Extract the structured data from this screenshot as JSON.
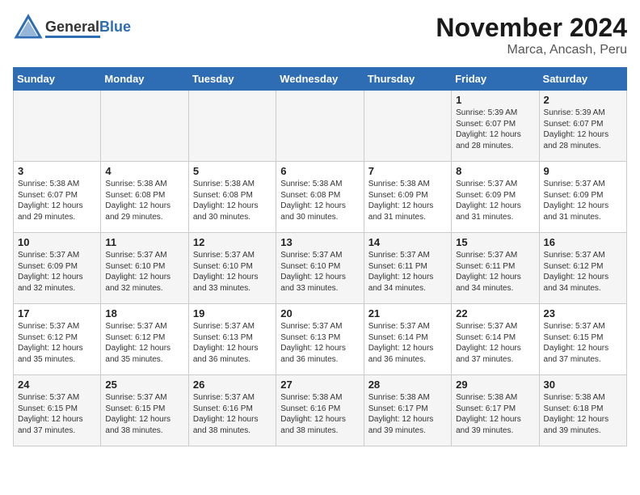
{
  "header": {
    "logo_general": "General",
    "logo_blue": "Blue",
    "title": "November 2024",
    "subtitle": "Marca, Ancash, Peru"
  },
  "calendar": {
    "days_of_week": [
      "Sunday",
      "Monday",
      "Tuesday",
      "Wednesday",
      "Thursday",
      "Friday",
      "Saturday"
    ],
    "weeks": [
      [
        {
          "day": "",
          "content": ""
        },
        {
          "day": "",
          "content": ""
        },
        {
          "day": "",
          "content": ""
        },
        {
          "day": "",
          "content": ""
        },
        {
          "day": "",
          "content": ""
        },
        {
          "day": "1",
          "content": "Sunrise: 5:39 AM\nSunset: 6:07 PM\nDaylight: 12 hours and 28 minutes."
        },
        {
          "day": "2",
          "content": "Sunrise: 5:39 AM\nSunset: 6:07 PM\nDaylight: 12 hours and 28 minutes."
        }
      ],
      [
        {
          "day": "3",
          "content": "Sunrise: 5:38 AM\nSunset: 6:07 PM\nDaylight: 12 hours and 29 minutes."
        },
        {
          "day": "4",
          "content": "Sunrise: 5:38 AM\nSunset: 6:08 PM\nDaylight: 12 hours and 29 minutes."
        },
        {
          "day": "5",
          "content": "Sunrise: 5:38 AM\nSunset: 6:08 PM\nDaylight: 12 hours and 30 minutes."
        },
        {
          "day": "6",
          "content": "Sunrise: 5:38 AM\nSunset: 6:08 PM\nDaylight: 12 hours and 30 minutes."
        },
        {
          "day": "7",
          "content": "Sunrise: 5:38 AM\nSunset: 6:09 PM\nDaylight: 12 hours and 31 minutes."
        },
        {
          "day": "8",
          "content": "Sunrise: 5:37 AM\nSunset: 6:09 PM\nDaylight: 12 hours and 31 minutes."
        },
        {
          "day": "9",
          "content": "Sunrise: 5:37 AM\nSunset: 6:09 PM\nDaylight: 12 hours and 31 minutes."
        }
      ],
      [
        {
          "day": "10",
          "content": "Sunrise: 5:37 AM\nSunset: 6:09 PM\nDaylight: 12 hours and 32 minutes."
        },
        {
          "day": "11",
          "content": "Sunrise: 5:37 AM\nSunset: 6:10 PM\nDaylight: 12 hours and 32 minutes."
        },
        {
          "day": "12",
          "content": "Sunrise: 5:37 AM\nSunset: 6:10 PM\nDaylight: 12 hours and 33 minutes."
        },
        {
          "day": "13",
          "content": "Sunrise: 5:37 AM\nSunset: 6:10 PM\nDaylight: 12 hours and 33 minutes."
        },
        {
          "day": "14",
          "content": "Sunrise: 5:37 AM\nSunset: 6:11 PM\nDaylight: 12 hours and 34 minutes."
        },
        {
          "day": "15",
          "content": "Sunrise: 5:37 AM\nSunset: 6:11 PM\nDaylight: 12 hours and 34 minutes."
        },
        {
          "day": "16",
          "content": "Sunrise: 5:37 AM\nSunset: 6:12 PM\nDaylight: 12 hours and 34 minutes."
        }
      ],
      [
        {
          "day": "17",
          "content": "Sunrise: 5:37 AM\nSunset: 6:12 PM\nDaylight: 12 hours and 35 minutes."
        },
        {
          "day": "18",
          "content": "Sunrise: 5:37 AM\nSunset: 6:12 PM\nDaylight: 12 hours and 35 minutes."
        },
        {
          "day": "19",
          "content": "Sunrise: 5:37 AM\nSunset: 6:13 PM\nDaylight: 12 hours and 36 minutes."
        },
        {
          "day": "20",
          "content": "Sunrise: 5:37 AM\nSunset: 6:13 PM\nDaylight: 12 hours and 36 minutes."
        },
        {
          "day": "21",
          "content": "Sunrise: 5:37 AM\nSunset: 6:14 PM\nDaylight: 12 hours and 36 minutes."
        },
        {
          "day": "22",
          "content": "Sunrise: 5:37 AM\nSunset: 6:14 PM\nDaylight: 12 hours and 37 minutes."
        },
        {
          "day": "23",
          "content": "Sunrise: 5:37 AM\nSunset: 6:15 PM\nDaylight: 12 hours and 37 minutes."
        }
      ],
      [
        {
          "day": "24",
          "content": "Sunrise: 5:37 AM\nSunset: 6:15 PM\nDaylight: 12 hours and 37 minutes."
        },
        {
          "day": "25",
          "content": "Sunrise: 5:37 AM\nSunset: 6:15 PM\nDaylight: 12 hours and 38 minutes."
        },
        {
          "day": "26",
          "content": "Sunrise: 5:37 AM\nSunset: 6:16 PM\nDaylight: 12 hours and 38 minutes."
        },
        {
          "day": "27",
          "content": "Sunrise: 5:38 AM\nSunset: 6:16 PM\nDaylight: 12 hours and 38 minutes."
        },
        {
          "day": "28",
          "content": "Sunrise: 5:38 AM\nSunset: 6:17 PM\nDaylight: 12 hours and 39 minutes."
        },
        {
          "day": "29",
          "content": "Sunrise: 5:38 AM\nSunset: 6:17 PM\nDaylight: 12 hours and 39 minutes."
        },
        {
          "day": "30",
          "content": "Sunrise: 5:38 AM\nSunset: 6:18 PM\nDaylight: 12 hours and 39 minutes."
        }
      ]
    ]
  }
}
